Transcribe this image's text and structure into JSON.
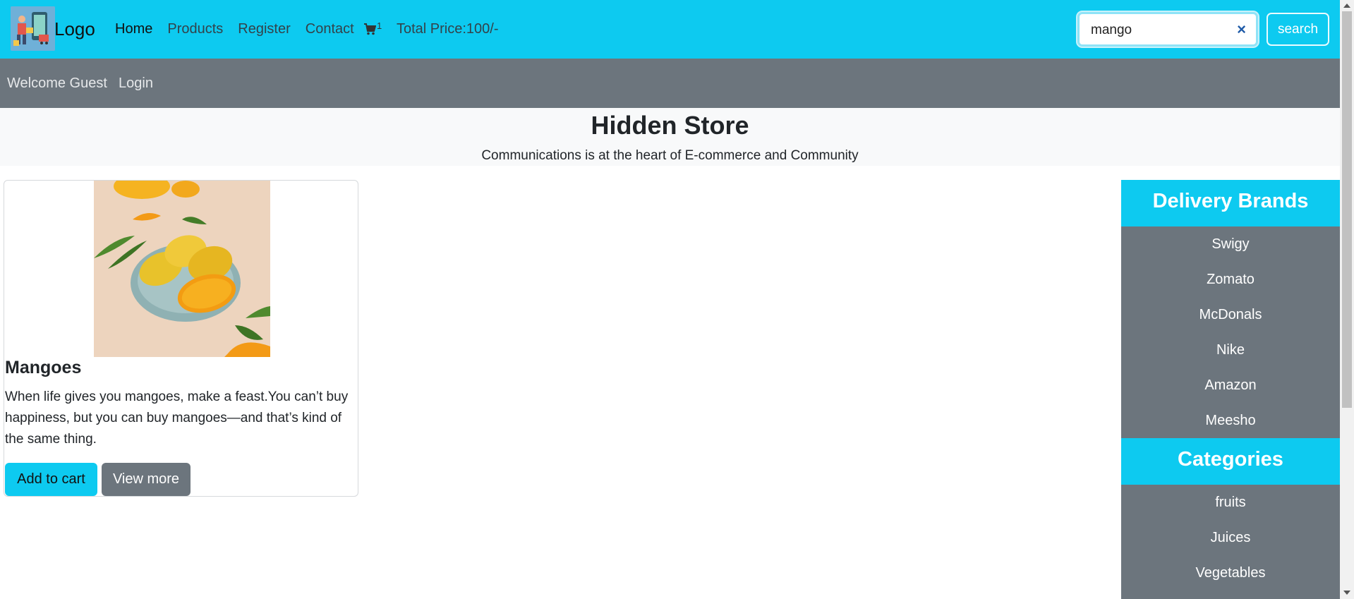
{
  "navbar": {
    "logo_text": "Logo",
    "links": [
      "Home",
      "Products",
      "Register",
      "Contact"
    ],
    "cart_count": "1",
    "total_price": "Total Price:100/-",
    "search_value": "mango",
    "search_button": "search",
    "clear_icon": "×"
  },
  "subnav": {
    "welcome": "Welcome Guest",
    "login": "Login"
  },
  "hero": {
    "title": "Hidden Store",
    "subtitle": "Communications is at the heart of E-commerce and Community"
  },
  "product": {
    "title": "Mangoes",
    "description": "When life gives you mangoes, make a feast.You can’t buy happiness, but you can buy mangoes—and that’s kind of the same thing.",
    "add_to_cart": "Add to cart",
    "view_more": "View more"
  },
  "sidebar": {
    "brands_heading": "Delivery Brands",
    "brands": [
      "Swigy",
      "Zomato",
      "McDonals",
      "Nike",
      "Amazon",
      "Meesho"
    ],
    "categories_heading": "Categories",
    "categories": [
      "fruits",
      "Juices",
      "Vegetables"
    ]
  },
  "colors": {
    "accent": "#0dcaf0",
    "secondary": "#6c757d"
  }
}
